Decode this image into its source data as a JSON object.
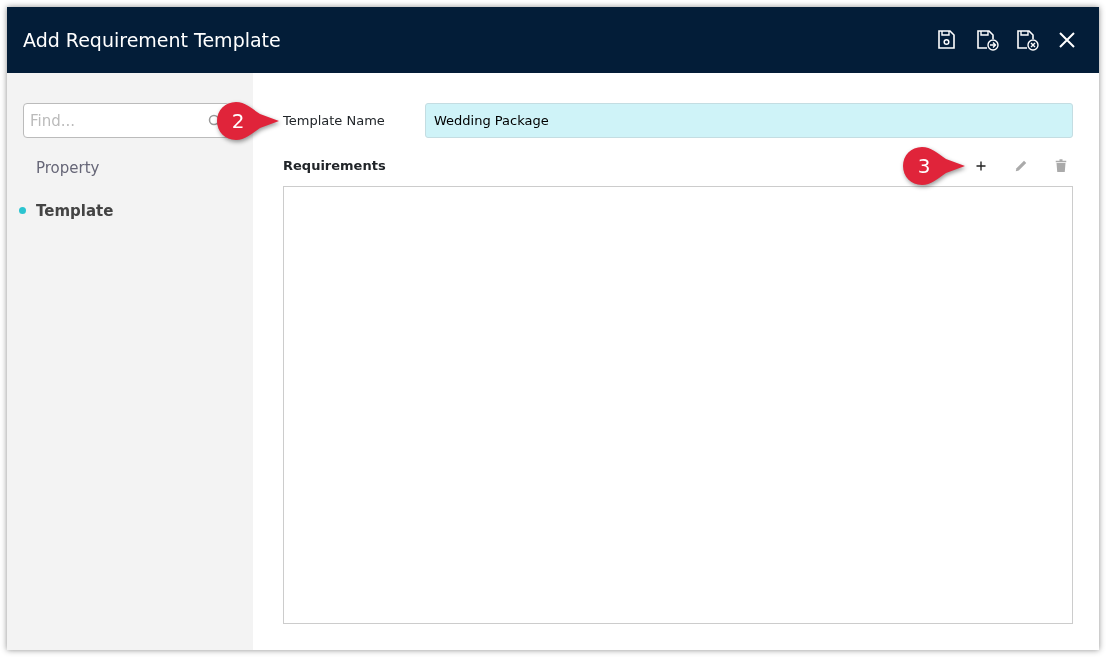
{
  "window": {
    "title": "Add Requirement Template"
  },
  "header_actions": [
    {
      "kind": "save"
    },
    {
      "kind": "save-new"
    },
    {
      "kind": "save-close"
    },
    {
      "kind": "close"
    }
  ],
  "sidebar": {
    "search": {
      "placeholder": "Find..."
    },
    "items": [
      {
        "label": "Property",
        "selected": false
      },
      {
        "label": "Template",
        "selected": true
      }
    ]
  },
  "form": {
    "template_name": {
      "label": "Template Name",
      "value": "Wedding Package"
    },
    "requirements": {
      "title": "Requirements",
      "actions": [
        {
          "kind": "add",
          "disabled": false
        },
        {
          "kind": "edit",
          "disabled": true
        },
        {
          "kind": "delete",
          "disabled": true
        }
      ]
    }
  },
  "callouts": [
    {
      "text": "2"
    },
    {
      "text": "3"
    }
  ]
}
